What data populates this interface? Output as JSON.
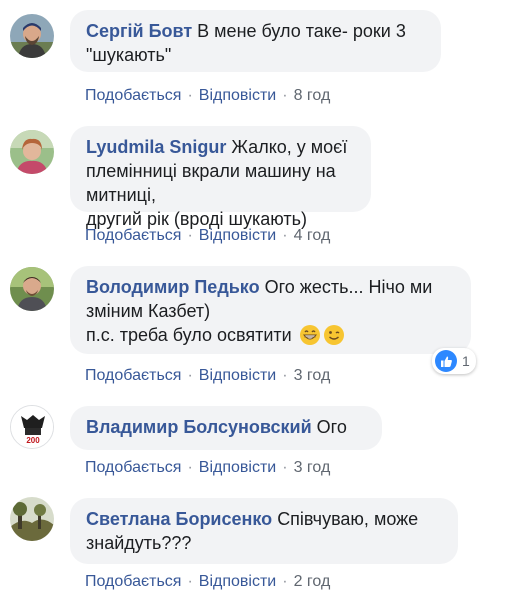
{
  "comments": [
    {
      "author": "Сергій Бовт",
      "text_lines": [
        "В мене було таке- роки 3",
        "\"шукають\""
      ],
      "like": "Подобається",
      "reply": "Відповісти",
      "time": "8 год",
      "avatar_icon": "man-avatar-photo"
    },
    {
      "author": "Lyudmila Snigur",
      "text_lines": [
        "Жалко, у моєї",
        "племінниці вкрали машину на митниці,",
        "другий рік (вроді шукають)"
      ],
      "like": "Подобається",
      "reply": "Відповісти",
      "time": "4 год",
      "avatar_icon": "woman-avatar-photo"
    },
    {
      "author": "Володимир Педько",
      "text_lines": [
        "Ого жесть... Нічо ми",
        "зміним Казбет)",
        "п.с. треба було освятити"
      ],
      "like": "Подобається",
      "reply": "Відповісти",
      "time": "3 год",
      "avatar_icon": "man-avatar-photo",
      "reaction_count": "1"
    },
    {
      "author": "Владимир Болсуновский",
      "text_lines": [
        "Ого"
      ],
      "like": "Подобається",
      "reply": "Відповісти",
      "time": "3 год",
      "avatar_icon": "logo-avatar",
      "avatar_text": "200"
    },
    {
      "author": "Светлана Борисенко",
      "text_lines": [
        "Співчуваю, може",
        "знайдуть???"
      ],
      "like": "Подобається",
      "reply": "Відповісти",
      "time": "2 год",
      "avatar_icon": "landscape-avatar-photo"
    }
  ],
  "colors": {
    "author": "#385898",
    "bubble": "#f2f3f5",
    "meta": "#606770",
    "like_badge": "#2d88ff"
  }
}
